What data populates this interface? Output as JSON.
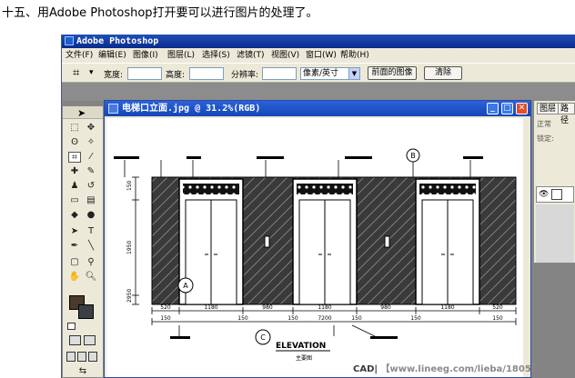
{
  "caption": "十五、用Adobe Photoshop打开要可以进行图片的处理了。",
  "app": {
    "title": "Adobe Photoshop"
  },
  "menu": [
    {
      "label": "文件(F)"
    },
    {
      "label": "编辑(E)"
    },
    {
      "label": "图像(I)"
    },
    {
      "label": "图层(L)"
    },
    {
      "label": "选择(S)"
    },
    {
      "label": "滤镜(T)"
    },
    {
      "label": "视图(V)"
    },
    {
      "label": "窗口(W)"
    },
    {
      "label": "帮助(H)"
    }
  ],
  "options": {
    "width_label": "宽度:",
    "height_label": "高度:",
    "resolution_label": "分辨率:",
    "unit_value": "像素/英寸",
    "front_image_button": "前面的图像",
    "clear_button": "清除"
  },
  "document": {
    "title": "电梯口立面.jpg @ 31.2%(RGB)"
  },
  "drawing": {
    "dims_top": [
      "520",
      "1180",
      "980",
      "1180",
      "980",
      "1180",
      "520"
    ],
    "dims_bottom": [
      "150",
      "150",
      "150",
      "7200",
      "150",
      "150",
      "150"
    ],
    "left_dims": [
      "150",
      "1950",
      "2950"
    ],
    "elevation_label": "ELEVATION",
    "elevation_sub": "主要图",
    "grid_a": "A",
    "grid_b": "B",
    "grid_c": "C"
  },
  "panel": {
    "tab_layers": "图层",
    "tab_paths": "路径",
    "blend_mode": "正常",
    "lock_label": "锁定:"
  },
  "watermark": {
    "cad": "CAD|",
    "url": "【www.lineeg.com/lieba/1805】"
  },
  "colors": {
    "titlebar": "#0a2a8c",
    "menu_bg": "#ece9d8",
    "workspace": "#848484",
    "close_button": "#e0502a"
  }
}
